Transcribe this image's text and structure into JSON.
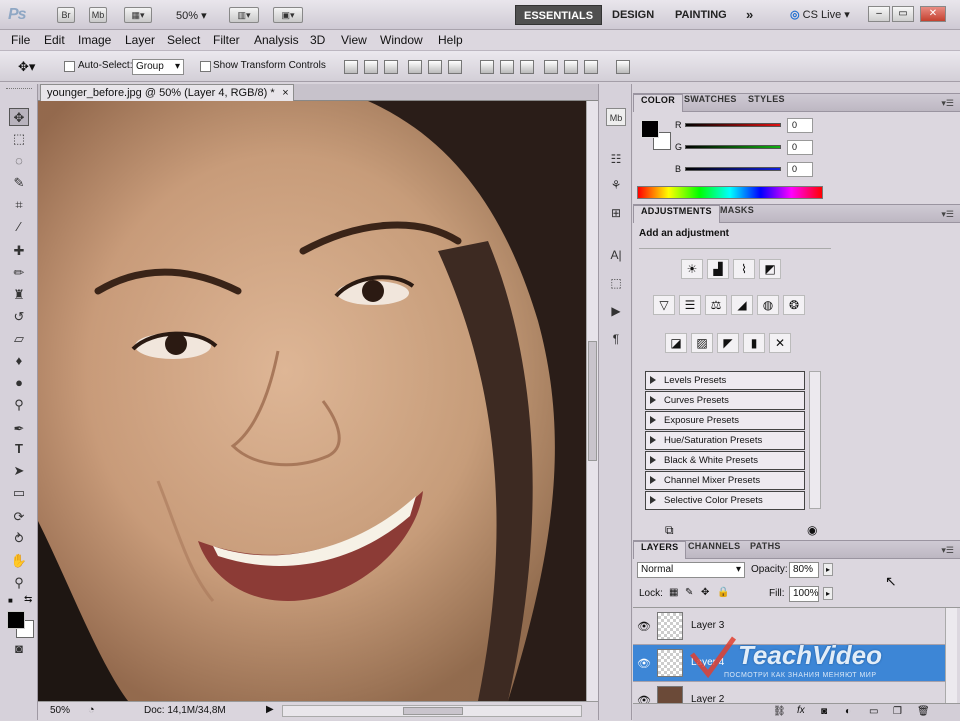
{
  "app": {
    "logo": "Ps",
    "bridge_label": "Br",
    "mini_bridge_label": "Mb",
    "zoom": "50%",
    "workspaces": [
      "ESSENTIALS",
      "DESIGN",
      "PAINTING"
    ],
    "more": "»",
    "cs_live": "CS Live",
    "window_buttons": [
      "–",
      "▭",
      "✕"
    ]
  },
  "menu": [
    "File",
    "Edit",
    "Image",
    "Layer",
    "Select",
    "Filter",
    "Analysis",
    "3D",
    "View",
    "Window",
    "Help"
  ],
  "options": {
    "auto_select_label": "Auto-Select:",
    "auto_select_value": "Group",
    "show_transform_label": "Show Transform Controls"
  },
  "document": {
    "tab_title": "younger_before.jpg @ 50% (Layer 4, RGB/8) *",
    "close": "×",
    "status_zoom": "50%",
    "status_doc": "Doc: 14,1M/34,8M"
  },
  "color_panel": {
    "tabs": [
      "COLOR",
      "SWATCHES",
      "STYLES"
    ],
    "channels": [
      {
        "label": "R",
        "value": "0",
        "color": "#e01010"
      },
      {
        "label": "G",
        "value": "0",
        "color": "#10b010"
      },
      {
        "label": "B",
        "value": "0",
        "color": "#1020e0"
      }
    ]
  },
  "adjustments_panel": {
    "tabs": [
      "ADJUSTMENTS",
      "MASKS"
    ],
    "heading": "Add an adjustment",
    "icons_row1": [
      "brightness-contrast",
      "levels",
      "curves",
      "exposure"
    ],
    "icons_row2": [
      "vibrance",
      "hue-saturation",
      "color-balance",
      "black-white",
      "photo-filter",
      "channel-mixer"
    ],
    "icons_row3": [
      "invert",
      "posterize",
      "threshold",
      "gradient-map",
      "selective-color"
    ],
    "presets": [
      "Levels Presets",
      "Curves Presets",
      "Exposure Presets",
      "Hue/Saturation Presets",
      "Black & White Presets",
      "Channel Mixer Presets",
      "Selective Color Presets"
    ]
  },
  "layers_panel": {
    "tabs": [
      "LAYERS",
      "CHANNELS",
      "PATHS"
    ],
    "blend_mode": "Normal",
    "opacity_label": "Opacity:",
    "opacity_value": "80%",
    "lock_label": "Lock:",
    "fill_label": "Fill:",
    "fill_value": "100%",
    "layers": [
      {
        "name": "Layer 3",
        "selected": false
      },
      {
        "name": "Layer 4",
        "selected": true
      },
      {
        "name": "Layer 2",
        "selected": false
      }
    ]
  },
  "watermark": {
    "brand": "TeachVideo",
    "tagline": "ПОСМОТРИ КАК ЗНАНИЯ МЕНЯЮТ МИР"
  },
  "colors": {
    "accent_selected": "#3d86d6",
    "workspace_active": "#505050"
  }
}
